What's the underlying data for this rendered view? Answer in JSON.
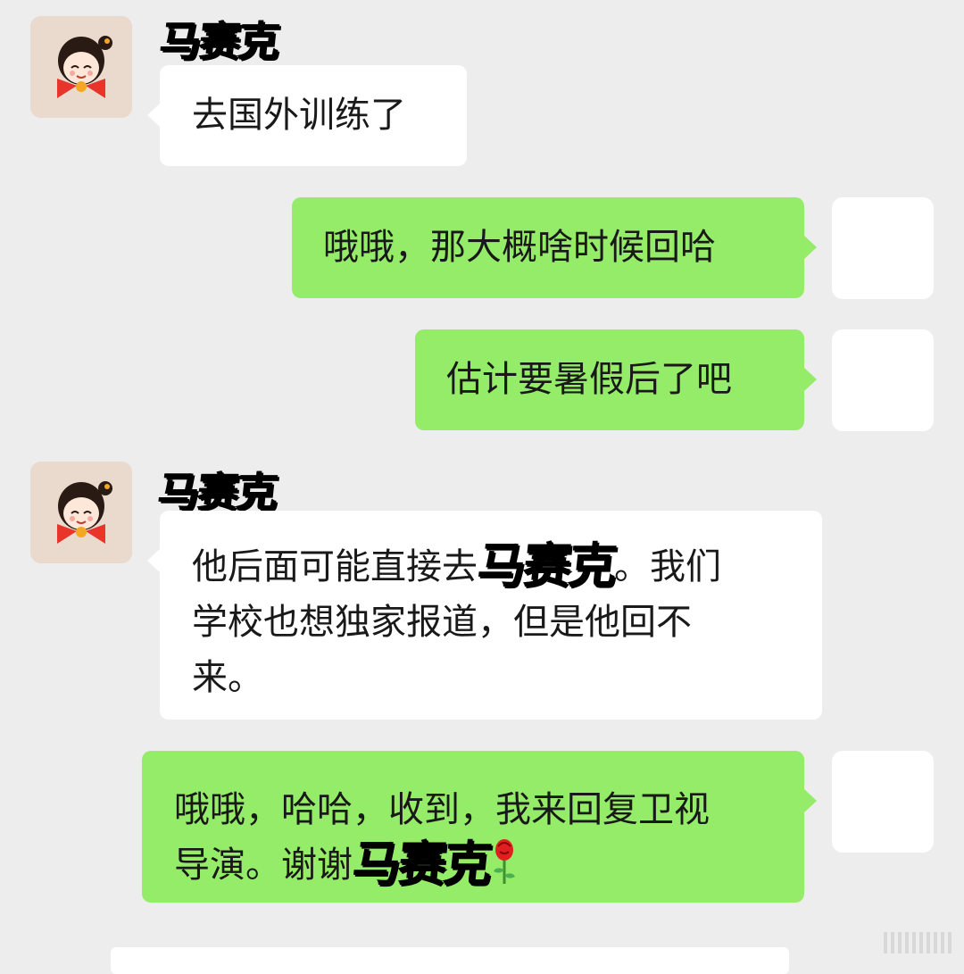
{
  "messages": [
    {
      "sender": "马赛克",
      "text": "去国外训练了"
    },
    {
      "text": "哦哦，那大概啥时候回哈"
    },
    {
      "text": "估计要暑假后了吧"
    },
    {
      "sender": "马赛克",
      "text_before": "他后面可能直接去",
      "inline_name": "马赛克",
      "text_after_line1": "。我们",
      "line2": "学校也想独家报道，但是他回不",
      "line3": "来。"
    },
    {
      "line1": "哦哦，哈哈，收到，我来回复卫视",
      "line2_before": "导演。谢谢",
      "inline_name": "马赛克",
      "emoji": "rose"
    }
  ],
  "colors": {
    "background": "#ededed",
    "incoming_bubble": "#ffffff",
    "outgoing_bubble": "#95ec69"
  }
}
